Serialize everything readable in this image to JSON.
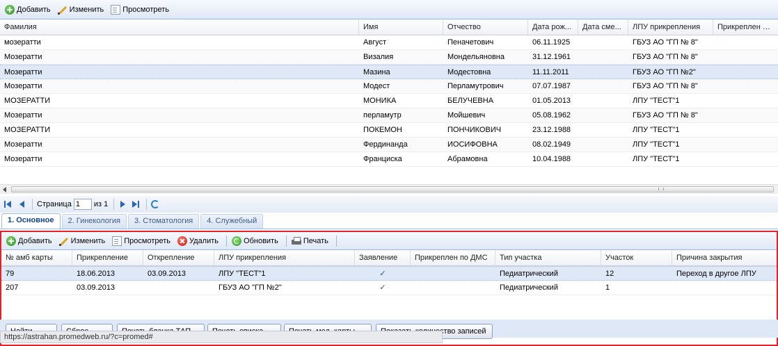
{
  "top_toolbar": {
    "add_label": "Добавить",
    "edit_label": "Изменить",
    "view_label": "Просмотреть"
  },
  "people_grid": {
    "columns": [
      "Фамилия",
      "Имя",
      "Отчество",
      "Дата рож...",
      "Дата сме...",
      "ЛПУ прикрепления",
      "Прикреплен по Д"
    ],
    "rows": [
      {
        "surname": "мозератти",
        "name": "Август",
        "patronymic": "Пеначетович",
        "birth": "06.11.1925",
        "death": "",
        "lpu": "ГБУЗ АО \"ГП № 8\""
      },
      {
        "surname": "Мозератти",
        "name": "Визалия",
        "patronymic": "Мондельяновна",
        "birth": "31.12.1961",
        "death": "",
        "lpu": "ГБУЗ АО \"ГП № 8\""
      },
      {
        "surname": "Мозератти",
        "name": "Мазина",
        "patronymic": "Модестовна",
        "birth": "11.11.2011",
        "death": "",
        "lpu": "ГБУЗ АО \"ГП №2\""
      },
      {
        "surname": "Мозератти",
        "name": "Модест",
        "patronymic": "Перламутрович",
        "birth": "07.07.1987",
        "death": "",
        "lpu": "ГБУЗ АО \"ГП № 8\""
      },
      {
        "surname": "МОЗЕРАТТИ",
        "name": "МОНИКА",
        "patronymic": "БЕЛУЧЕВНА",
        "birth": "01.05.2013",
        "death": "",
        "lpu": "ЛПУ \"ТЕСТ\"1"
      },
      {
        "surname": "Мозератти",
        "name": "перламутр",
        "patronymic": "Мойшевич",
        "birth": "05.08.1962",
        "death": "",
        "lpu": "ГБУЗ АО \"ГП № 8\""
      },
      {
        "surname": "МОЗЕРАТТИ",
        "name": "ПОКЕМОН",
        "patronymic": "ПОНЧИКОВИЧ",
        "birth": "23.12.1988",
        "death": "",
        "lpu": "ЛПУ \"ТЕСТ\"1"
      },
      {
        "surname": "Мозератти",
        "name": "Фердинанда",
        "patronymic": "ИОСИФОВНА",
        "birth": "08.02.1949",
        "death": "",
        "lpu": "ЛПУ \"ТЕСТ\"1"
      },
      {
        "surname": "Мозератти",
        "name": "Франциска",
        "patronymic": "Абрамовна",
        "birth": "10.04.1988",
        "death": "",
        "lpu": "ЛПУ \"ТЕСТ\"1"
      }
    ],
    "selected_index": 2
  },
  "paging": {
    "page_label": "Страница",
    "page_value": "1",
    "of_label": "из 1"
  },
  "tabs": [
    "1. Основное",
    "2. Гинекология",
    "3. Стоматология",
    "4. Служебный"
  ],
  "lower_toolbar": {
    "add_label": "Добавить",
    "edit_label": "Изменить",
    "view_label": "Просмотреть",
    "delete_label": "Удалить",
    "refresh_label": "Обновить",
    "print_label": "Печать"
  },
  "attach_grid": {
    "columns": [
      "№ амб карты",
      "Прикрепление",
      "Открепление",
      "ЛПУ прикрепления",
      "Заявление",
      "Прикреплен по ДМС",
      "Тип участка",
      "Участок",
      "Причина закрытия"
    ],
    "rows": [
      {
        "card": "79",
        "attach": "18.06.2013",
        "detach": "03.09.2013",
        "lpu": "ЛПУ \"ТЕСТ\"1",
        "statement": "✓",
        "dms": "",
        "type": "Педиатрический",
        "uchastok": "12",
        "reason": "Переход в другое ЛПУ"
      },
      {
        "card": "207",
        "attach": "03.09.2013",
        "detach": "",
        "lpu": "ГБУЗ АО \"ГП №2\"",
        "statement": "✓",
        "dms": "",
        "type": "Педиатрический",
        "uchastok": "1",
        "reason": ""
      }
    ]
  },
  "footer_buttons": [
    "Найти",
    "Сброс",
    "Печать бланка ТАП",
    "Печать списка",
    "Печать мед. карты",
    "Показать количество записей"
  ],
  "status_url": "https://astrahan.promedweb.ru/?c=promed#",
  "colors": {
    "highlight_border": "#e8202a",
    "selected_row": "#dfe8f6",
    "header_blue": "#15428b"
  }
}
